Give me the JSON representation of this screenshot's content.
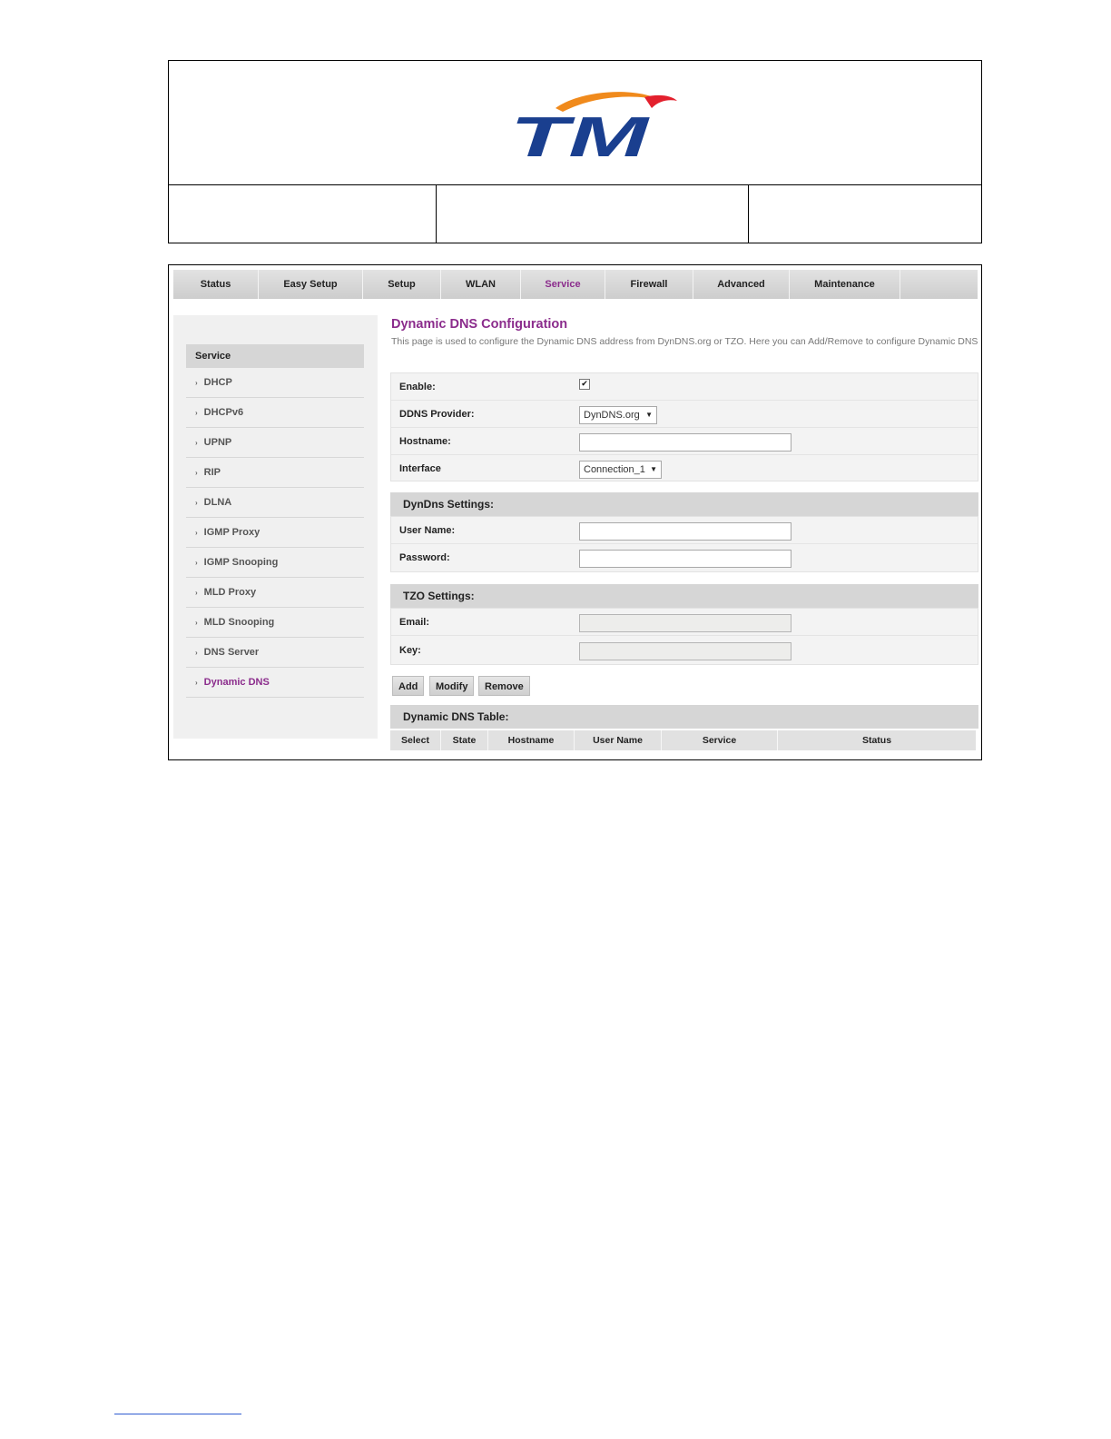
{
  "brand": {
    "logo_text": "TM",
    "colors": {
      "blue": "#1a3f8f",
      "orange": "#f08a1c",
      "red": "#e3202d",
      "accent": "#8b2c8c"
    }
  },
  "topnav": {
    "tabs": [
      {
        "label": "Status"
      },
      {
        "label": "Easy Setup"
      },
      {
        "label": "Setup"
      },
      {
        "label": "WLAN"
      },
      {
        "label": "Service",
        "active": true
      },
      {
        "label": "Firewall"
      },
      {
        "label": "Advanced"
      },
      {
        "label": "Maintenance"
      }
    ]
  },
  "sidebar": {
    "title": "Service",
    "items": [
      {
        "label": "DHCP"
      },
      {
        "label": "DHCPv6"
      },
      {
        "label": "UPNP"
      },
      {
        "label": "RIP"
      },
      {
        "label": "DLNA"
      },
      {
        "label": "IGMP Proxy"
      },
      {
        "label": "IGMP Snooping"
      },
      {
        "label": "MLD Proxy"
      },
      {
        "label": "MLD Snooping"
      },
      {
        "label": "DNS Server"
      },
      {
        "label": "Dynamic DNS",
        "active": true
      }
    ],
    "arrow_glyph": "›"
  },
  "main": {
    "title": "Dynamic DNS Configuration",
    "description": "This page is used to configure the Dynamic DNS address from DynDNS.org or TZO. Here you can Add/Remove to configure Dynamic DNS",
    "general": {
      "enable_label": "Enable:",
      "enable_checked": true,
      "check_glyph": "✔",
      "provider_label": "DDNS Provider:",
      "provider_value": "DynDNS.org",
      "hostname_label": "Hostname:",
      "hostname_value": "",
      "interface_label": "Interface",
      "interface_value": "Connection_1",
      "caret_glyph": "▼"
    },
    "dyndns": {
      "heading": "DynDns Settings:",
      "username_label": "User Name:",
      "username_value": "",
      "password_label": "Password:",
      "password_value": ""
    },
    "tzo": {
      "heading": "TZO Settings:",
      "email_label": "Email:",
      "email_value": "",
      "key_label": "Key:",
      "key_value": ""
    },
    "buttons": {
      "add": "Add",
      "modify": "Modify",
      "remove": "Remove"
    },
    "table": {
      "heading": "Dynamic DNS Table:",
      "columns": [
        "Select",
        "State",
        "Hostname",
        "User Name",
        "Service",
        "Status"
      ]
    }
  }
}
